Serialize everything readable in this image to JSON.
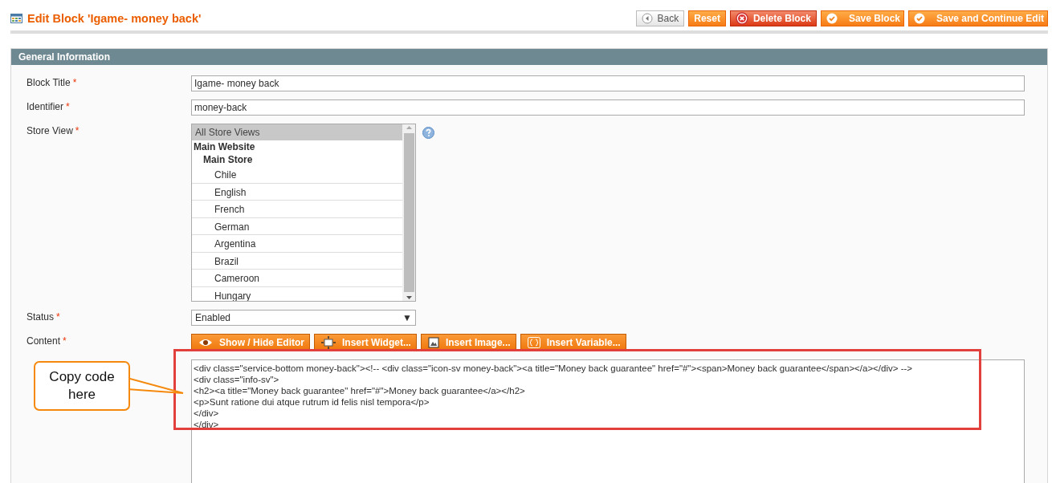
{
  "page_title": "Edit Block 'Igame- money back'",
  "actions": [
    {
      "label": "Back",
      "kind": "back"
    },
    {
      "label": "Reset",
      "kind": "plain"
    },
    {
      "label": "Delete Block",
      "kind": "delete"
    },
    {
      "label": "Save Block",
      "kind": "save"
    },
    {
      "label": "Save and Continue Edit",
      "kind": "save"
    }
  ],
  "section": {
    "title": "General Information"
  },
  "fields": {
    "block_title": {
      "label": "Block Title",
      "required_mark": "*",
      "value": "Igame- money back"
    },
    "identifier": {
      "label": "Identifier",
      "required_mark": "*",
      "value": "money-back"
    },
    "store_view": {
      "label": "Store View",
      "required_mark": "*",
      "options": [
        {
          "label": "All Store Views",
          "kind": "all",
          "selected": true
        },
        {
          "label": "Main Website",
          "kind": "website",
          "selected": false
        },
        {
          "label": "Main Store",
          "kind": "store",
          "selected": false
        },
        {
          "label": "Chile",
          "kind": "view",
          "selected": false
        },
        {
          "label": "English",
          "kind": "view",
          "selected": false
        },
        {
          "label": "French",
          "kind": "view",
          "selected": false
        },
        {
          "label": "German",
          "kind": "view",
          "selected": false
        },
        {
          "label": "Argentina",
          "kind": "view",
          "selected": false
        },
        {
          "label": "Brazil",
          "kind": "view",
          "selected": false
        },
        {
          "label": "Cameroon",
          "kind": "view",
          "selected": false
        },
        {
          "label": "Hungary",
          "kind": "view",
          "selected": false
        }
      ]
    },
    "status": {
      "label": "Status",
      "required_mark": "*",
      "value": "Enabled",
      "arrow": "▼"
    },
    "content": {
      "label": "Content",
      "required_mark": "*",
      "buttons": [
        {
          "label": "Show / Hide Editor"
        },
        {
          "label": "Insert Widget..."
        },
        {
          "label": "Insert Image..."
        },
        {
          "label": "Insert Variable..."
        }
      ],
      "code_lines": [
        "<div class=\"service-bottom money-back\"><!-- <div class=\"icon-sv money-back\"><a title=\"Money back guarantee\" href=\"#\"><span>Money back guarantee</span></a></div> -->",
        "<div class=\"info-sv\">",
        "<h2><a title=\"Money back guarantee\" href=\"#\">Money back guarantee</a></h2>",
        "<p>Sunt ratione dui atque rutrum id felis nisl tempora</p>",
        "</div>",
        "</div>"
      ]
    }
  },
  "callout": {
    "text": "Copy code here"
  }
}
